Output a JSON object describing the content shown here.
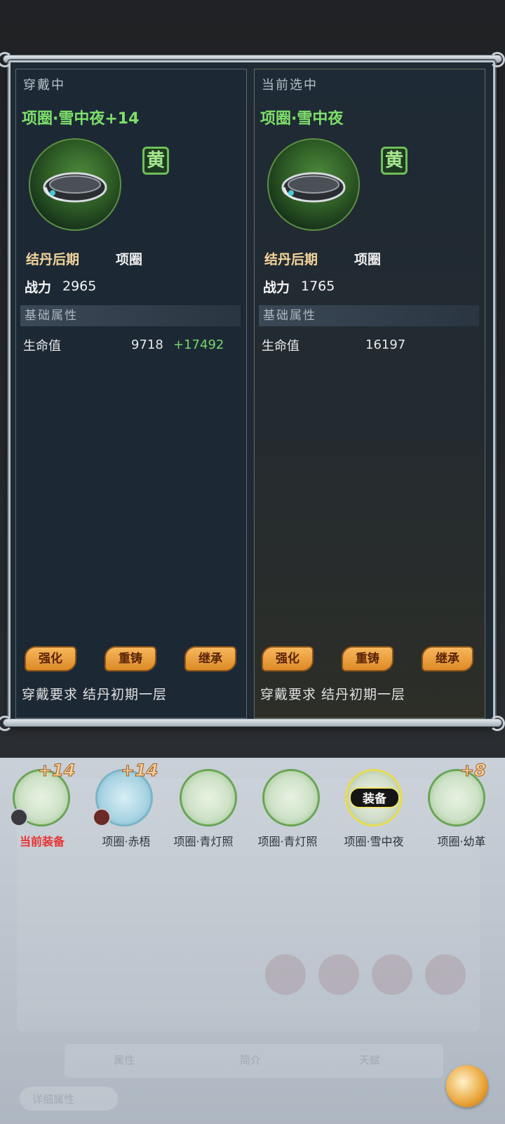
{
  "compare": {
    "left": {
      "header": "穿戴中",
      "item_name": "项圈·雪中夜+14",
      "grade": "黄",
      "realm": "结丹后期",
      "slot_type": "项圈",
      "power_label": "战力",
      "power_value": "2965",
      "section": "基础属性",
      "stat_name": "生命值",
      "stat_base": "9718",
      "stat_bonus": "+17492",
      "buttons": [
        "强化",
        "重铸",
        "继承"
      ],
      "requirement": "穿戴要求 结丹初期一层"
    },
    "right": {
      "header": "当前选中",
      "item_name": "项圈·雪中夜",
      "grade": "黄",
      "realm": "结丹后期",
      "slot_type": "项圈",
      "power_label": "战力",
      "power_value": "1765",
      "section": "基础属性",
      "stat_name": "生命值",
      "stat_base": "16197",
      "buttons": [
        "强化",
        "重铸",
        "继承"
      ],
      "requirement": "穿戴要求 结丹初期一层"
    }
  },
  "inventory": [
    {
      "label": "当前装备",
      "plus": "+14"
    },
    {
      "label": "项圈·赤梧",
      "plus": "+14"
    },
    {
      "label": "项圈·青灯照",
      "plus": ""
    },
    {
      "label": "项圈·青灯照",
      "plus": ""
    },
    {
      "label": "项圈·雪中夜",
      "plus": "",
      "badge": "装备"
    },
    {
      "label": "项圈·幼革",
      "plus": "+8"
    }
  ],
  "background_tabs": [
    "属性",
    "简介",
    "天赋"
  ],
  "background_detail": "详细属性"
}
